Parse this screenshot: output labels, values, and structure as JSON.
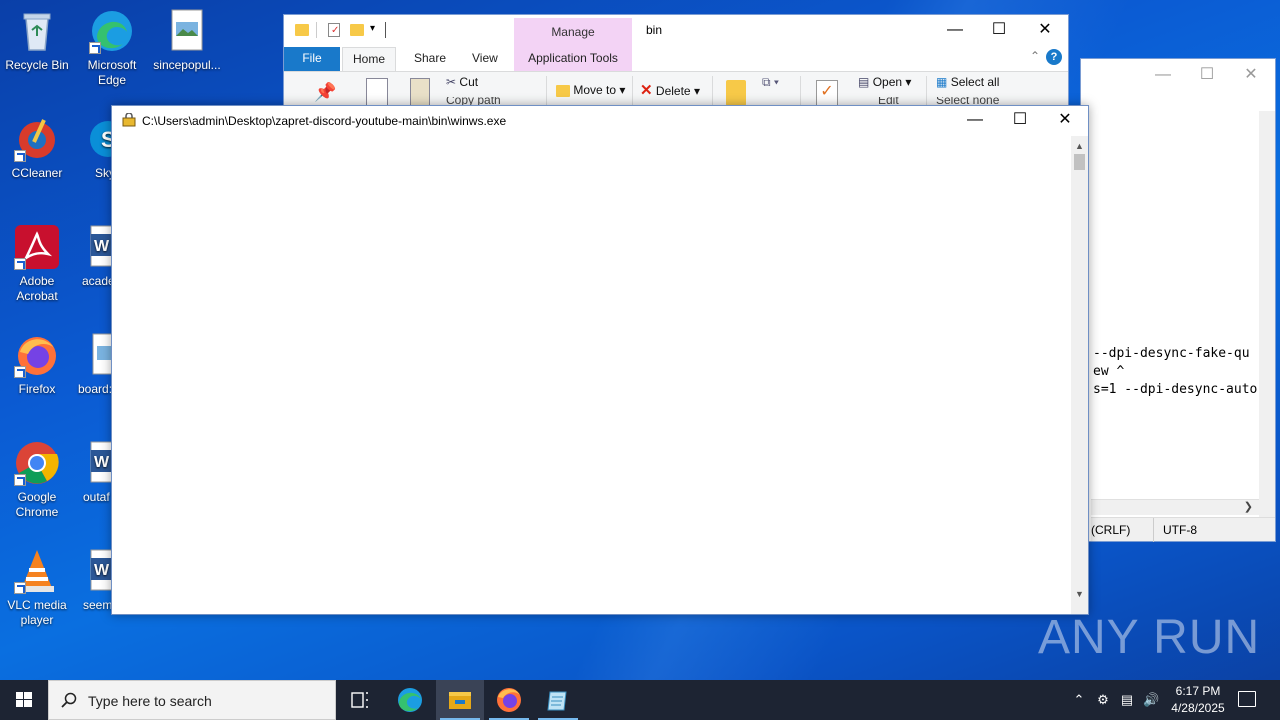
{
  "desktop": {
    "icons": [
      {
        "label": "Recycle Bin"
      },
      {
        "label": "Microsoft Edge"
      },
      {
        "label": "sincepopul..."
      },
      {
        "label": "CCleaner"
      },
      {
        "label": "Sky"
      },
      {
        "label": "Adobe Acrobat"
      },
      {
        "label": "acade"
      },
      {
        "label": "Firefox"
      },
      {
        "label": "board:"
      },
      {
        "label": "Google Chrome"
      },
      {
        "label": "outaf"
      },
      {
        "label": "VLC media player"
      },
      {
        "label": "seem"
      }
    ]
  },
  "explorer": {
    "manage_label": "Manage",
    "folder_name": "bin",
    "tabs": {
      "file": "File",
      "home": "Home",
      "share": "Share",
      "view": "View",
      "app_tools": "Application Tools"
    },
    "ribbon": {
      "cut": "Cut",
      "copy_path": "Copy path",
      "move_to": "Move to",
      "delete": "Delete",
      "open": "Open",
      "edit": "Edit",
      "select_all": "Select all",
      "select_none": "Select none"
    }
  },
  "notepad": {
    "lines": [
      "--dpi-desync-fake-qu",
      "ew ^",
      "s=1 --dpi-desync-auto"
    ],
    "line_ending": "(CRLF)",
    "encoding": "UTF-8"
  },
  "console": {
    "title": "C:\\Users\\admin\\Desktop\\zapret-discord-youtube-main\\bin\\winws.exe"
  },
  "watermark": "ANY RUN",
  "taskbar": {
    "search_placeholder": "Type here to search",
    "time": "6:17 PM",
    "date": "4/28/2025"
  },
  "colors": {
    "accent": "#1979ca",
    "manage_tab": "#f3d3f5",
    "taskbar": "#1d2433"
  }
}
